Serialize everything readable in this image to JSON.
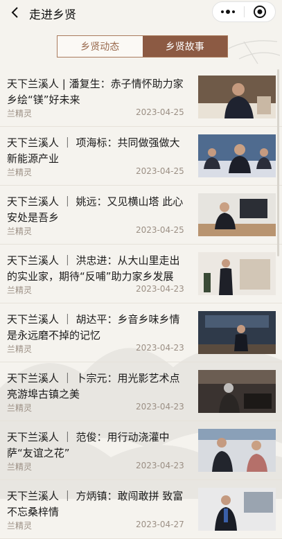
{
  "header": {
    "title": "走进乡贤",
    "back_icon": "chevron-left-icon",
    "more_icon": "more-dots-icon",
    "close_icon": "target-circle-icon"
  },
  "tabs": [
    {
      "label": "乡贤动态",
      "active": false
    },
    {
      "label": "乡贤故事",
      "active": true
    }
  ],
  "colors": {
    "accent": "#8c5a43",
    "background": "#f5f3ee",
    "meta": "#9b8f84"
  },
  "articles": [
    {
      "title": "天下兰溪人 | 潘复生：赤子情怀助力家乡绘“镁”好未来",
      "source": "兰精灵",
      "date": "2023-04-25"
    },
    {
      "title": "天下兰溪人 ｜ 项海标：共同做强做大新能源产业",
      "source": "兰精灵",
      "date": "2023-04-25"
    },
    {
      "title": "天下兰溪人 ｜ 姚远：又见横山塔 此心安处是吾乡",
      "source": "兰精灵",
      "date": "2023-04-25"
    },
    {
      "title": "天下兰溪人 ｜ 洪忠进：从大山里走出的实业家，期待“反哺”助力家乡发展",
      "source": "兰精灵",
      "date": "2023-04-23"
    },
    {
      "title": "天下兰溪人 ｜ 胡达平：乡音乡味乡情是永远磨不掉的记忆",
      "source": "兰精灵",
      "date": "2023-04-23"
    },
    {
      "title": "天下兰溪人 ｜ 卜宗元：用光影艺术点亮游埠古镇之美",
      "source": "兰精灵",
      "date": "2023-04-23"
    },
    {
      "title": "天下兰溪人 ｜ 范俊：用行动浇灌中萨“友谊之花”",
      "source": "兰精灵",
      "date": "2023-04-23"
    },
    {
      "title": "天下兰溪人 ｜ 方炳镇：敢闯敢拼 致富不忘桑梓情",
      "source": "兰精灵",
      "date": "2023-04-27"
    }
  ]
}
